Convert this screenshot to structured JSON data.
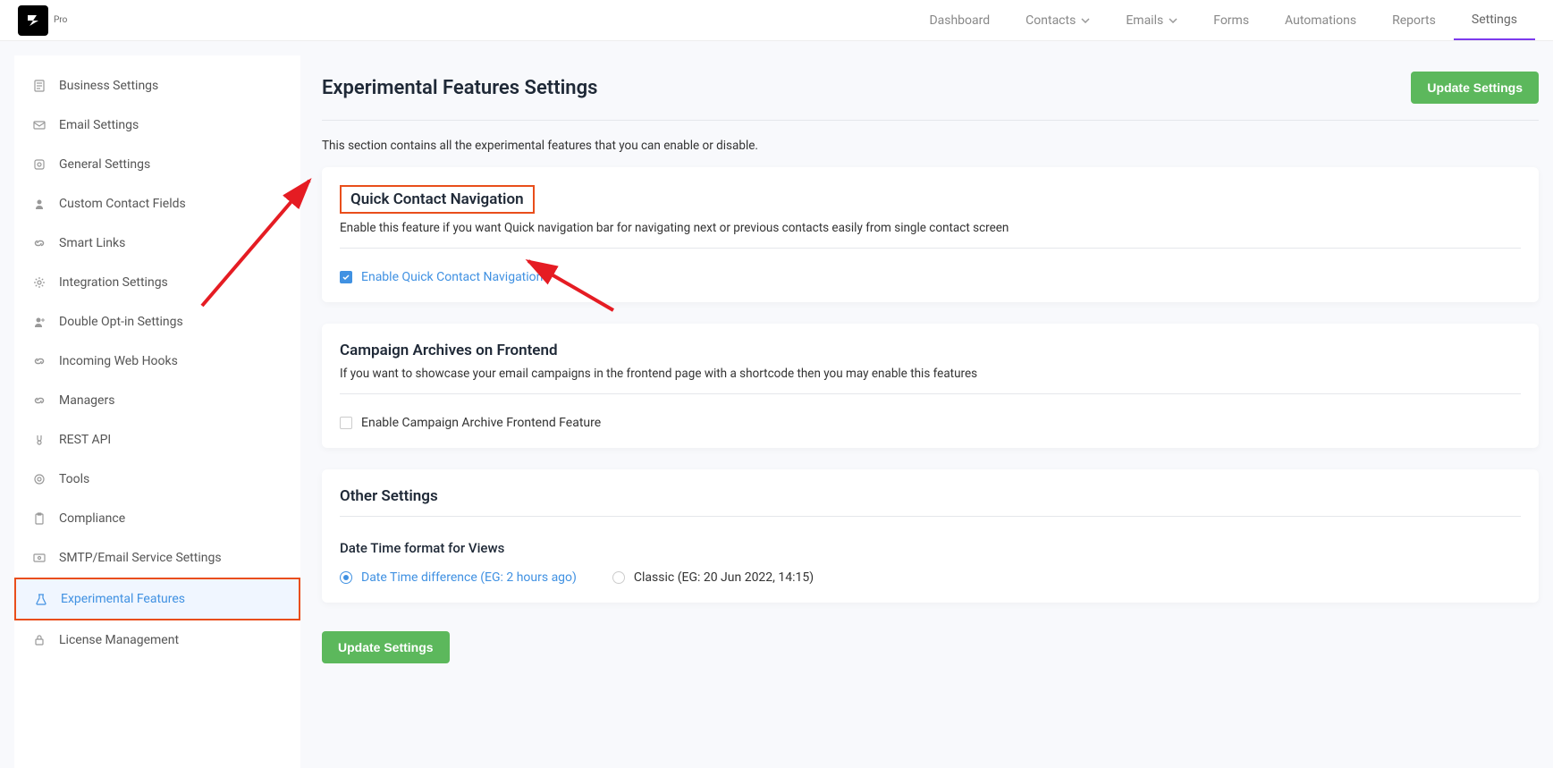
{
  "header": {
    "logo_pro": "Pro",
    "nav": {
      "dashboard": "Dashboard",
      "contacts": "Contacts",
      "emails": "Emails",
      "forms": "Forms",
      "automations": "Automations",
      "reports": "Reports",
      "settings": "Settings"
    }
  },
  "sidebar": {
    "business": "Business Settings",
    "email": "Email Settings",
    "general": "General Settings",
    "custom_fields": "Custom Contact Fields",
    "smart_links": "Smart Links",
    "integration": "Integration Settings",
    "double_optin": "Double Opt-in Settings",
    "webhooks": "Incoming Web Hooks",
    "managers": "Managers",
    "rest_api": "REST API",
    "tools": "Tools",
    "compliance": "Compliance",
    "smtp": "SMTP/Email Service Settings",
    "experimental": "Experimental Features",
    "license": "License Management"
  },
  "page": {
    "title": "Experimental Features Settings",
    "update_btn": "Update Settings",
    "description": "This section contains all the experimental features that you can enable or disable."
  },
  "card1": {
    "title": "Quick Contact Navigation",
    "subtext": "Enable this feature if you want Quick navigation bar for navigating next or previous contacts easily from single contact screen",
    "checkbox_label": "Enable Quick Contact Navigation"
  },
  "card2": {
    "title": "Campaign Archives on Frontend",
    "subtext": "If you want to showcase your email campaigns in the frontend page with a shortcode then you may enable this features",
    "checkbox_label": "Enable Campaign Archive Frontend Feature"
  },
  "card3": {
    "title": "Other Settings",
    "sub_heading": "Date Time format for Views",
    "radio1": "Date Time difference (EG: 2 hours ago)",
    "radio2": "Classic (EG: 20 Jun 2022, 14:15)"
  },
  "bottom": {
    "update_btn": "Update Settings"
  }
}
